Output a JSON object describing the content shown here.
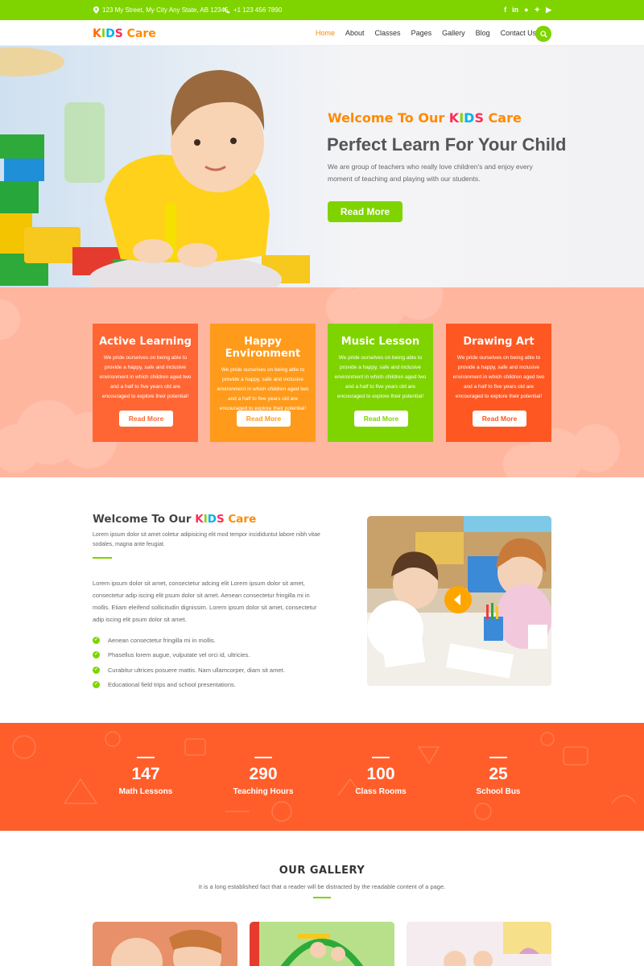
{
  "topbar": {
    "address": "123 My Street, My City Any State, AB 12345.",
    "phone": "+1 123 456 7890",
    "social": [
      "f",
      "in",
      "p",
      "t",
      "yt"
    ]
  },
  "nav": {
    "logo": {
      "k": "K",
      "i": "I",
      "d": "D",
      "s": "S",
      "care": "Care"
    },
    "items": [
      {
        "label": "Home",
        "active": true
      },
      {
        "label": "About"
      },
      {
        "label": "Classes"
      },
      {
        "label": "Pages"
      },
      {
        "label": "Gallery"
      },
      {
        "label": "Blog"
      },
      {
        "label": "Contact Us"
      }
    ]
  },
  "hero": {
    "subtitle_pre": "Welcome To Our ",
    "subtitle_kids": {
      "k": "K",
      "i": "I",
      "d": "D",
      "s": "S"
    },
    "subtitle_post": " Care",
    "title": "Perfect Learn For Your Child",
    "description": "We are group of teachers who really love children's and enjoy every moment of teaching and playing with our students.",
    "button": "Read More"
  },
  "features": [
    {
      "title": "Active Learning",
      "text": "We pride ourselves on being able to provide a happy, safe and inclusive environment in which children aged two and a half to five years old are encouraged to explore their potential!",
      "button": "Read More",
      "color": "#ff6633"
    },
    {
      "title": "Happy Environment",
      "text": "We pride ourselves on being able to provide a happy, safe and inclusive environment in which children aged two and a half to five years old are encouraged to explore their potential!",
      "button": "Read More",
      "color": "#ff9a1a"
    },
    {
      "title": "Music Lesson",
      "text": "We pride ourselves on being able to provide a happy, safe and inclusive environment in which children aged two and a half to five years old are encouraged to explore their potential!",
      "button": "Read More",
      "color": "#7fd400"
    },
    {
      "title": "Drawing Art",
      "text": "We pride ourselves on being able to provide a happy, safe and inclusive environment in which children aged two and a half to five years old are encouraged to explore their potential!",
      "button": "Read More",
      "color": "#ff5722"
    }
  ],
  "about": {
    "title_pre": "Welcome To Our ",
    "title_kids": {
      "k": "K",
      "i": "I",
      "d": "D",
      "s": "S"
    },
    "title_post": " Care",
    "lead": "Lorem ipsum dolor sit amet coletur adipisicing elit mod tempor incididuntut labore nibh vitae sodales, magna ante feugiat.",
    "body": "Lorem ipsum dolor sit amet, consectetur adcing elit Lorem ipsum dolor sit amet, consectetur adip iscing elit psum dolor sit amet. Aenean consectetur fringilla mi in mollis. Etiam eleifend sollicitudin dignissim. Lorem ipsum dolor sit amet, consectetur adip iscing elit psum dolor sit amet.",
    "list": [
      "Aenean consectetur fringilla mi in mollis.",
      "Phasellus lorem augue, vulputate vel orci id, ultricies.",
      "Curabitur ultrices posuere mattis. Nam ullamcorper, diam sit amet.",
      "Educational field trips and school presentations."
    ]
  },
  "stats": [
    {
      "value": "147",
      "label": "Math Lessons"
    },
    {
      "value": "290",
      "label": "Teaching Hours"
    },
    {
      "value": "100",
      "label": "Class Rooms"
    },
    {
      "value": "25",
      "label": "School Bus"
    }
  ],
  "gallery": {
    "title": "OUR GALLERY",
    "subtitle": "It is a long established fact that a reader will be distracted by the readable content of a page."
  },
  "colors": {
    "green": "#7fd400",
    "orange": "#ff8a00",
    "peach": "#ffb69e",
    "stats_bg": "#ff5e2b"
  }
}
